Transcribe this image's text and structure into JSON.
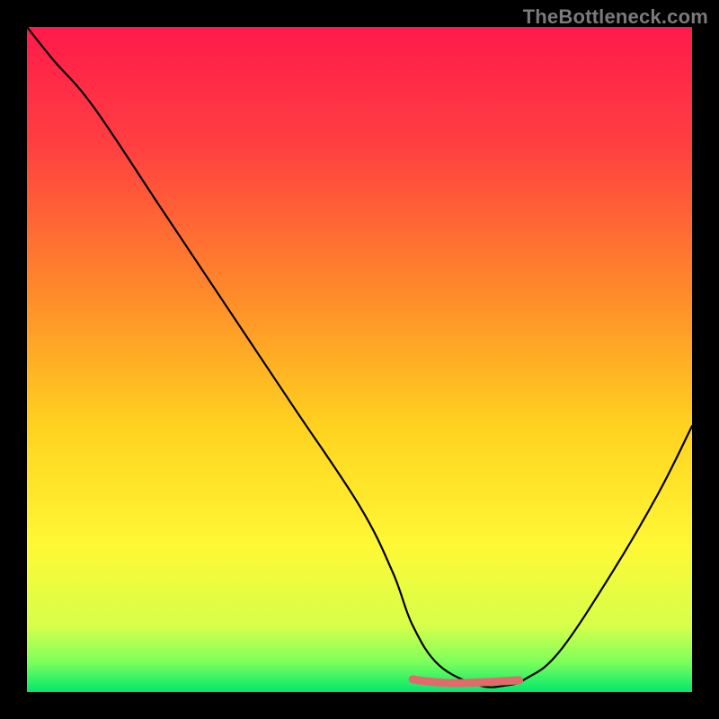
{
  "watermark": "TheBottleneck.com",
  "chart_data": {
    "type": "line",
    "title": "",
    "xlabel": "",
    "ylabel": "",
    "xlim": [
      0,
      100
    ],
    "ylim": [
      0,
      100
    ],
    "gradient_stops": [
      {
        "offset": 0,
        "color": "#ff1a4b"
      },
      {
        "offset": 0.18,
        "color": "#ff4040"
      },
      {
        "offset": 0.4,
        "color": "#ff8a2a"
      },
      {
        "offset": 0.6,
        "color": "#ffd21f"
      },
      {
        "offset": 0.78,
        "color": "#fff835"
      },
      {
        "offset": 0.9,
        "color": "#d7ff4a"
      },
      {
        "offset": 0.955,
        "color": "#7dff5c"
      },
      {
        "offset": 1.0,
        "color": "#00e86b"
      }
    ],
    "series": [
      {
        "name": "bottleneck-curve",
        "color": "#000000",
        "x": [
          0,
          4,
          10,
          20,
          30,
          40,
          50,
          55,
          58,
          62,
          68,
          72,
          75,
          80,
          88,
          95,
          100
        ],
        "y": [
          100,
          95,
          88,
          73,
          58,
          43,
          28,
          18,
          10,
          4,
          1,
          1,
          2,
          6,
          18,
          30,
          40
        ]
      }
    ],
    "flat_segment": {
      "name": "optimal-range-marker",
      "color": "#e26a6a",
      "x_start": 58,
      "x_end": 74,
      "y": 1.5
    }
  }
}
